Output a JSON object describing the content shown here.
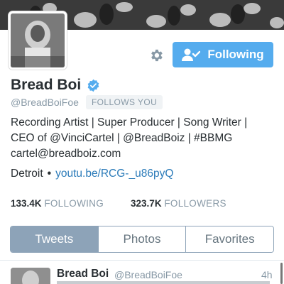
{
  "profile": {
    "display_name": "Bread Boi",
    "handle": "@BreadBoiFoe",
    "follows_you": "FOLLOWS YOU",
    "verified": true
  },
  "actions": {
    "following_label": "Following",
    "settings_icon": "gear-icon",
    "follow_icon": "person-check-icon"
  },
  "bio": {
    "line1": "Recording Artist | Super Producer | Song Writer |",
    "line2": "CEO of @VinciCartel | @BreadBoiz | #BBMG",
    "line3": "cartel@breadboiz.com"
  },
  "meta": {
    "location": "Detroit",
    "separator": "•",
    "website": "youtu.be/RCG-_u86pyQ"
  },
  "stats": {
    "following_count": "133.4K",
    "following_label": "FOLLOWING",
    "followers_count": "323.7K",
    "followers_label": "FOLLOWERS"
  },
  "tabs": [
    {
      "label": "Tweets",
      "active": true
    },
    {
      "label": "Photos",
      "active": false
    },
    {
      "label": "Favorites",
      "active": false
    }
  ],
  "tweet": {
    "name": "Bread Boi",
    "handle": "@BreadBoiFoe",
    "time": "4h"
  },
  "colors": {
    "accent": "#55acee",
    "link": "#2b7bb9",
    "muted": "#8899a6",
    "tab_active": "#8da3b8"
  }
}
